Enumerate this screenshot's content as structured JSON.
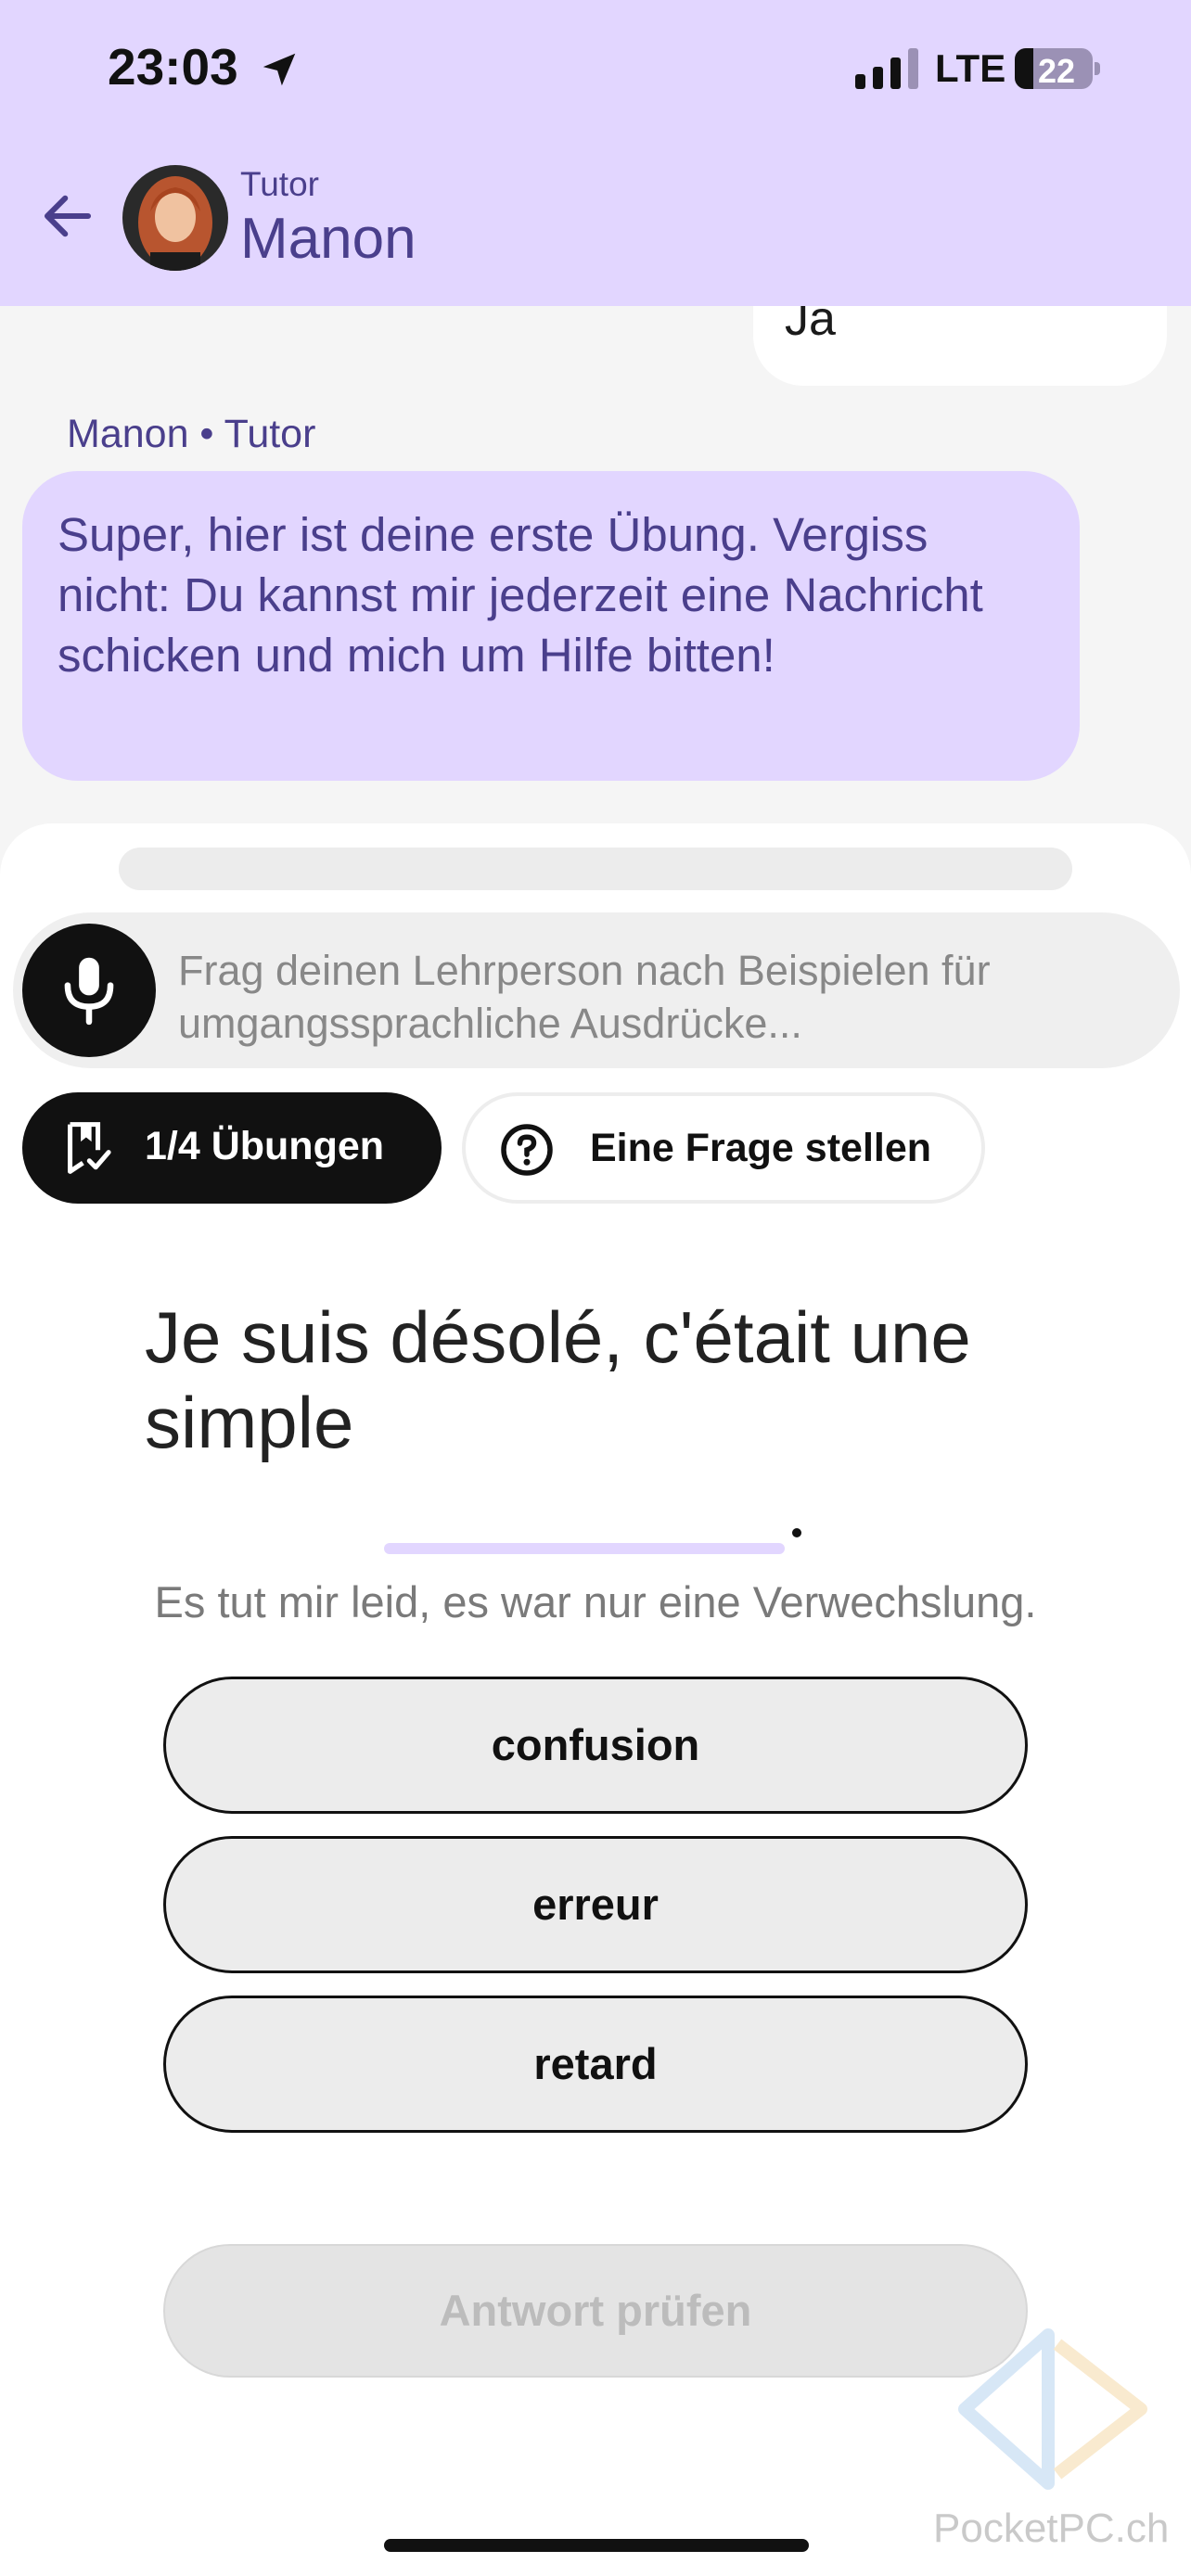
{
  "status_bar": {
    "time": "23:03",
    "network": "LTE",
    "battery": "22"
  },
  "header": {
    "subtitle": "Tutor",
    "name": "Manon"
  },
  "chat": {
    "user_message": "Ja",
    "tutor_meta": "Manon • Tutor",
    "tutor_message": "Super, hier ist deine erste Übung. Vergiss nicht: Du kannst mir jederzeit eine Nachricht schicken und mich um Hilfe bitten!"
  },
  "composer": {
    "placeholder": "Frag deinen Lehrperson nach Beispielen für umgangssprachliche Ausdrücke..."
  },
  "pills": {
    "exercises_label": "1/4 Übungen",
    "ask_label": "Eine Frage stellen"
  },
  "exercise": {
    "sentence": "Je suis désolé, c'était une simple",
    "sentence_end": ".",
    "translation": "Es tut mir leid, es war nur eine Verwechslung.",
    "options": [
      "confusion",
      "erreur",
      "retard"
    ],
    "check_label": "Antwort prüfen"
  },
  "watermark": "PocketPC.ch",
  "colors": {
    "accent": "#e2d6ff",
    "accent_text": "#4a3f8c",
    "dark": "#111111"
  },
  "icons": [
    "location-arrow-icon",
    "signal-icon",
    "battery-icon",
    "back-arrow-icon",
    "microphone-icon",
    "bookmark-check-icon",
    "question-circle-icon"
  ]
}
